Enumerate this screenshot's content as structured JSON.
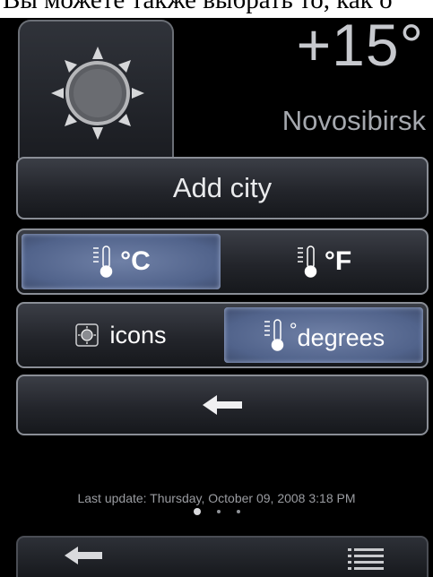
{
  "top_caption": "Вы можете также выбрать то, как о",
  "current": {
    "temperature": "+15°",
    "city": "Novosibirsk",
    "icon": "sun-icon"
  },
  "add_city_label": "Add city",
  "units": {
    "celsius_label": "°C",
    "fahrenheit_label": "°F",
    "selected": "celsius"
  },
  "display_mode": {
    "icons_label": "icons",
    "degrees_label": "degrees",
    "selected": "degrees"
  },
  "back_button_icon": "arrow-left-icon",
  "last_update": "Last update: Thursday, October 09, 2008 3:18 PM",
  "pager": {
    "pages": 3,
    "current": 1
  },
  "bottom_bar": {
    "left_icon": "arrow-left-icon",
    "right_icon": "list-icon"
  },
  "colors": {
    "active_segment": "#51638b",
    "background": "#000000",
    "border": "#8a8e96"
  }
}
